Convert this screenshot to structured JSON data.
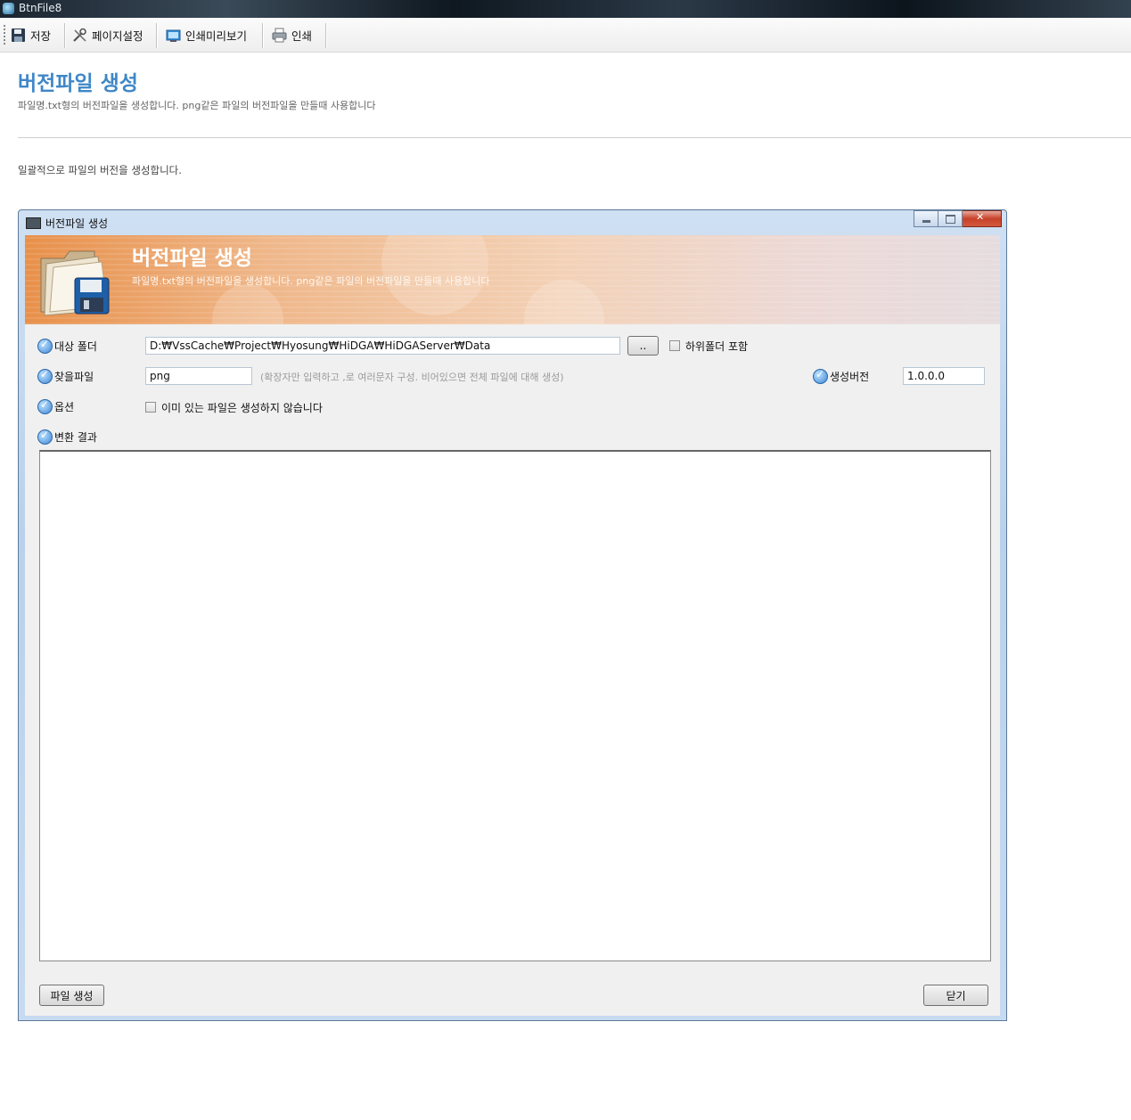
{
  "app": {
    "title": "BtnFile8"
  },
  "toolbar": {
    "save_label": "저장",
    "page_setup_label": "페이지설정",
    "print_preview_label": "인쇄미리보기",
    "print_label": "인쇄"
  },
  "page": {
    "title": "버전파일 생성",
    "subtitle": "파일명.txt형의 버전파일을 생성합니다. png같은 파일의 버전파일을 만들때 사용합니다",
    "description": "일괄적으로 파일의 버전을 생성합니다."
  },
  "dialog": {
    "window_title": "버전파일 생성",
    "banner_title": "버전파일 생성",
    "banner_subtitle": "파일명.txt형의 버전파일을 생성합니다. png같은 파일의 버전파일을 만들때 사용합니다",
    "target_folder_label": "대상 폴더",
    "target_folder_value": "D:₩VssCache₩Project₩Hyosung₩HiDGA₩HiDGAServer₩Data",
    "browse_label": "..",
    "include_subfolders_label": "하위폴더 포함",
    "find_file_label": "찾을파일",
    "find_file_value": "png",
    "find_file_hint": "(확장자만 입력하고 ,로 여러문자 구성. 비어있으면 전체 파일에 대해 생성)",
    "gen_version_label": "생성버전",
    "gen_version_value": "1.0.0.0",
    "option_label": "옵션",
    "skip_existing_label": "이미 있는 파일은 생성하지 않습니다",
    "result_label": "변환 결과",
    "create_button": "파일 생성",
    "close_button": "닫기"
  }
}
